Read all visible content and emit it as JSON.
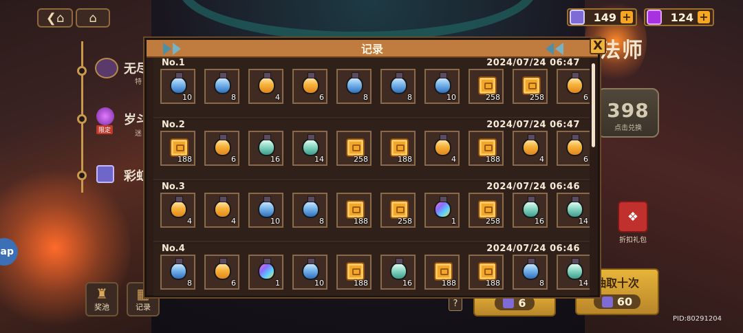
{
  "colors": {
    "modal_header": "#c07b3e",
    "accent_gold": "#f0b33a",
    "item_border": "#8a6a4a"
  },
  "top_bar": {
    "back_icon": "chevron-left-icon",
    "home_icon": "home-icon",
    "currencies": [
      {
        "icon": "blue-gem-icon",
        "amount": "149"
      },
      {
        "icon": "purple-gem-icon",
        "amount": "124"
      }
    ]
  },
  "left_panel": {
    "entries": [
      {
        "label": "无尽",
        "sub": "特"
      },
      {
        "label": "岁斗",
        "sub": "迷",
        "ribbon": "限定"
      },
      {
        "label": "彩虹"
      }
    ],
    "side_tab": "ap",
    "bottom_buttons": [
      {
        "label": "奖池",
        "icon": "prize-bag-icon"
      },
      {
        "label": "记录",
        "icon": "record-list-icon"
      }
    ]
  },
  "right_panel": {
    "title": "法师",
    "exchange": {
      "value": "398",
      "hint": "点击兑换"
    },
    "gift_label": "折扣礼包",
    "pull_ten": {
      "label": "抽取十次",
      "cost": "60"
    },
    "pull_one": {
      "cost": "6"
    },
    "help": "?",
    "pid": "PID:80291204"
  },
  "modal": {
    "title": "记录",
    "close_label": "X",
    "records": [
      {
        "no": "No.1",
        "time": "2024/07/24 06:47",
        "items": [
          {
            "type": "potion-blue",
            "qty": "10"
          },
          {
            "type": "potion-blue",
            "qty": "8"
          },
          {
            "type": "potion-orange",
            "qty": "4"
          },
          {
            "type": "potion-orange",
            "qty": "6"
          },
          {
            "type": "potion-blue",
            "qty": "8"
          },
          {
            "type": "potion-blue",
            "qty": "8"
          },
          {
            "type": "potion-blue",
            "qty": "10"
          },
          {
            "type": "ticket",
            "qty": "258"
          },
          {
            "type": "ticket",
            "qty": "258"
          },
          {
            "type": "potion-orange",
            "qty": "6"
          }
        ]
      },
      {
        "no": "No.2",
        "time": "2024/07/24 06:47",
        "items": [
          {
            "type": "ticket",
            "qty": "188"
          },
          {
            "type": "potion-orange",
            "qty": "6"
          },
          {
            "type": "potion-teal",
            "qty": "16"
          },
          {
            "type": "potion-teal",
            "qty": "14"
          },
          {
            "type": "ticket",
            "qty": "258"
          },
          {
            "type": "ticket",
            "qty": "188"
          },
          {
            "type": "potion-orange",
            "qty": "4"
          },
          {
            "type": "ticket",
            "qty": "188"
          },
          {
            "type": "potion-orange",
            "qty": "4"
          },
          {
            "type": "potion-orange",
            "qty": "6"
          }
        ]
      },
      {
        "no": "No.3",
        "time": "2024/07/24 06:46",
        "items": [
          {
            "type": "potion-orange",
            "qty": "4"
          },
          {
            "type": "potion-orange",
            "qty": "4"
          },
          {
            "type": "potion-blue",
            "qty": "10"
          },
          {
            "type": "potion-blue",
            "qty": "8"
          },
          {
            "type": "ticket",
            "qty": "188"
          },
          {
            "type": "ticket",
            "qty": "258"
          },
          {
            "type": "potion-rainbow",
            "qty": "1"
          },
          {
            "type": "ticket",
            "qty": "258"
          },
          {
            "type": "potion-teal",
            "qty": "16"
          },
          {
            "type": "potion-teal",
            "qty": "14"
          }
        ]
      },
      {
        "no": "No.4",
        "time": "2024/07/24 06:46",
        "items": [
          {
            "type": "potion-blue",
            "qty": "8"
          },
          {
            "type": "potion-orange",
            "qty": "6"
          },
          {
            "type": "potion-rainbow",
            "qty": "1"
          },
          {
            "type": "potion-blue",
            "qty": "10"
          },
          {
            "type": "ticket",
            "qty": "188"
          },
          {
            "type": "potion-teal",
            "qty": "16"
          },
          {
            "type": "ticket",
            "qty": "188"
          },
          {
            "type": "ticket",
            "qty": "188"
          },
          {
            "type": "potion-blue",
            "qty": "8"
          },
          {
            "type": "potion-teal",
            "qty": "14"
          }
        ]
      }
    ]
  }
}
